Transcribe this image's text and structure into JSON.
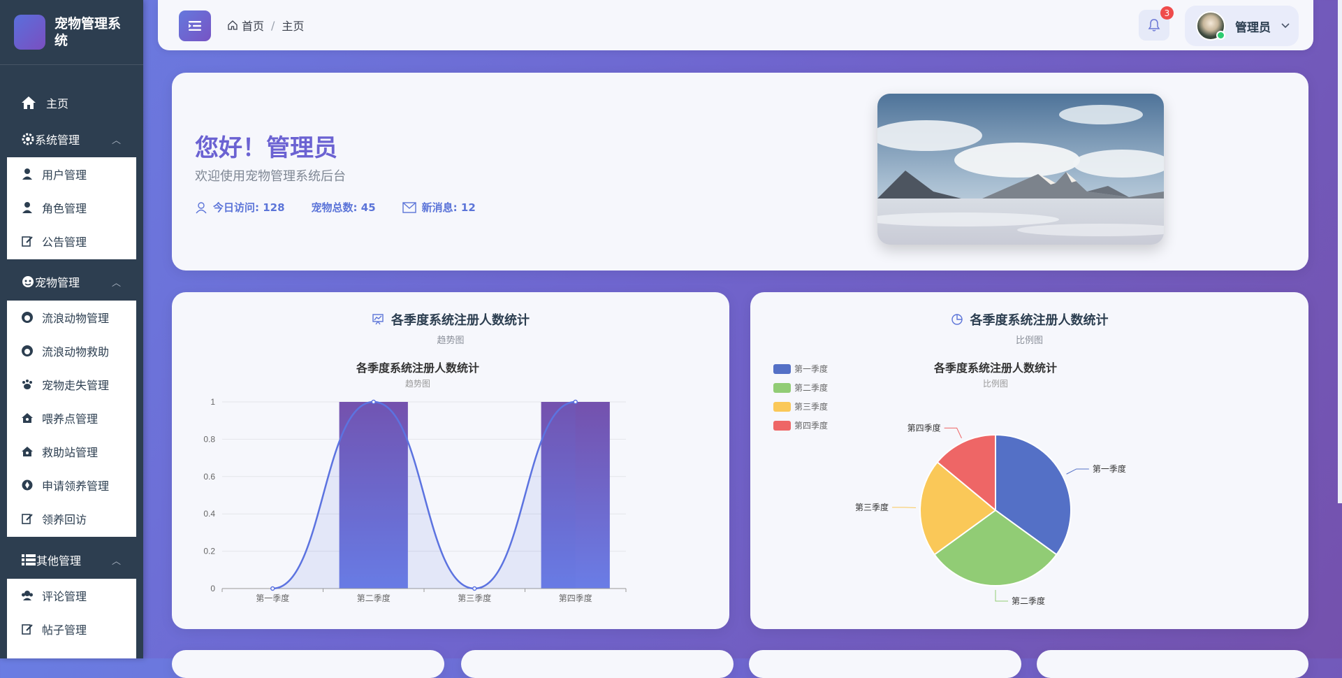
{
  "brand": {
    "title": "宠物管理系统"
  },
  "nav": {
    "home": "主页",
    "groups": [
      {
        "label": "系统管理",
        "items": [
          "用户管理",
          "角色管理",
          "公告管理"
        ]
      },
      {
        "label": "宠物管理",
        "items": [
          "流浪动物管理",
          "流浪动物救助",
          "宠物走失管理",
          "喂养点管理",
          "救助站管理",
          "申请领养管理",
          "领养回访"
        ]
      },
      {
        "label": "其他管理",
        "items": [
          "评论管理",
          "帖子管理"
        ]
      }
    ]
  },
  "header": {
    "breadcrumb": [
      "首页",
      "主页"
    ],
    "notification_count": "3",
    "user_name": "管理员"
  },
  "welcome": {
    "greeting": "您好！管理员",
    "subtitle": "欢迎使用宠物管理系统后台",
    "stats": {
      "visits": "今日访问: 128",
      "pets": "宠物总数: 45",
      "messages": "新消息: 12"
    }
  },
  "cards": [
    {
      "title": "各季度系统注册人数统计",
      "subtitle": "趋势图"
    },
    {
      "title": "各季度系统注册人数统计",
      "subtitle": "比例图"
    }
  ],
  "chart_data": [
    {
      "type": "bar",
      "title": "各季度系统注册人数统计",
      "subtitle": "趋势图",
      "categories": [
        "第一季度",
        "第二季度",
        "第三季度",
        "第四季度"
      ],
      "values": [
        0,
        1,
        0,
        1
      ],
      "ylim": [
        0,
        1
      ],
      "yticks": [
        "0",
        "0.2",
        "0.4",
        "0.6",
        "0.8",
        "1"
      ],
      "overlay": "smooth-line-area",
      "grid": true,
      "colors": {
        "bar_top": "#7451ad",
        "bar_bottom": "#6a7de6",
        "line": "#5c73e0"
      }
    },
    {
      "type": "pie",
      "title": "各季度系统注册人数统计",
      "subtitle": "比例图",
      "categories": [
        "第一季度",
        "第二季度",
        "第三季度",
        "第四季度"
      ],
      "values": [
        35,
        30,
        21,
        14
      ],
      "colors": [
        "#5470c6",
        "#91cc75",
        "#fac858",
        "#ee6666"
      ],
      "legend_position": "top-left"
    }
  ]
}
